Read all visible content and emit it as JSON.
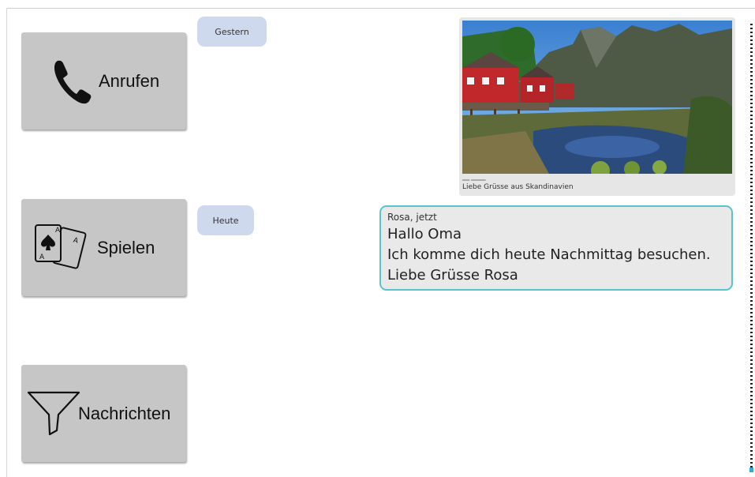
{
  "sidebar": {
    "call_label": "Anrufen",
    "play_label": "Spielen",
    "messages_label": "Nachrichten"
  },
  "chat": {
    "date_yesterday": "Gestern",
    "date_today": "Heute",
    "photo_message": {
      "caption": "Liebe Grüsse aus Skandinavien"
    },
    "text_message": {
      "sender": "Rosa, jetzt",
      "lines": [
        "Hallo Oma",
        "Ich komme dich heute Nachmittag besuchen.",
        "Liebe Grüsse Rosa"
      ]
    }
  },
  "icons": {
    "call": "phone-icon",
    "play": "playing-cards-icon",
    "messages": "filter-funnel-icon"
  },
  "colors": {
    "button_bg": "#c6c6c6",
    "date_pill_bg": "#cfd9ee",
    "message_border": "#59c4cc",
    "message_bg": "#e9e9e9"
  }
}
